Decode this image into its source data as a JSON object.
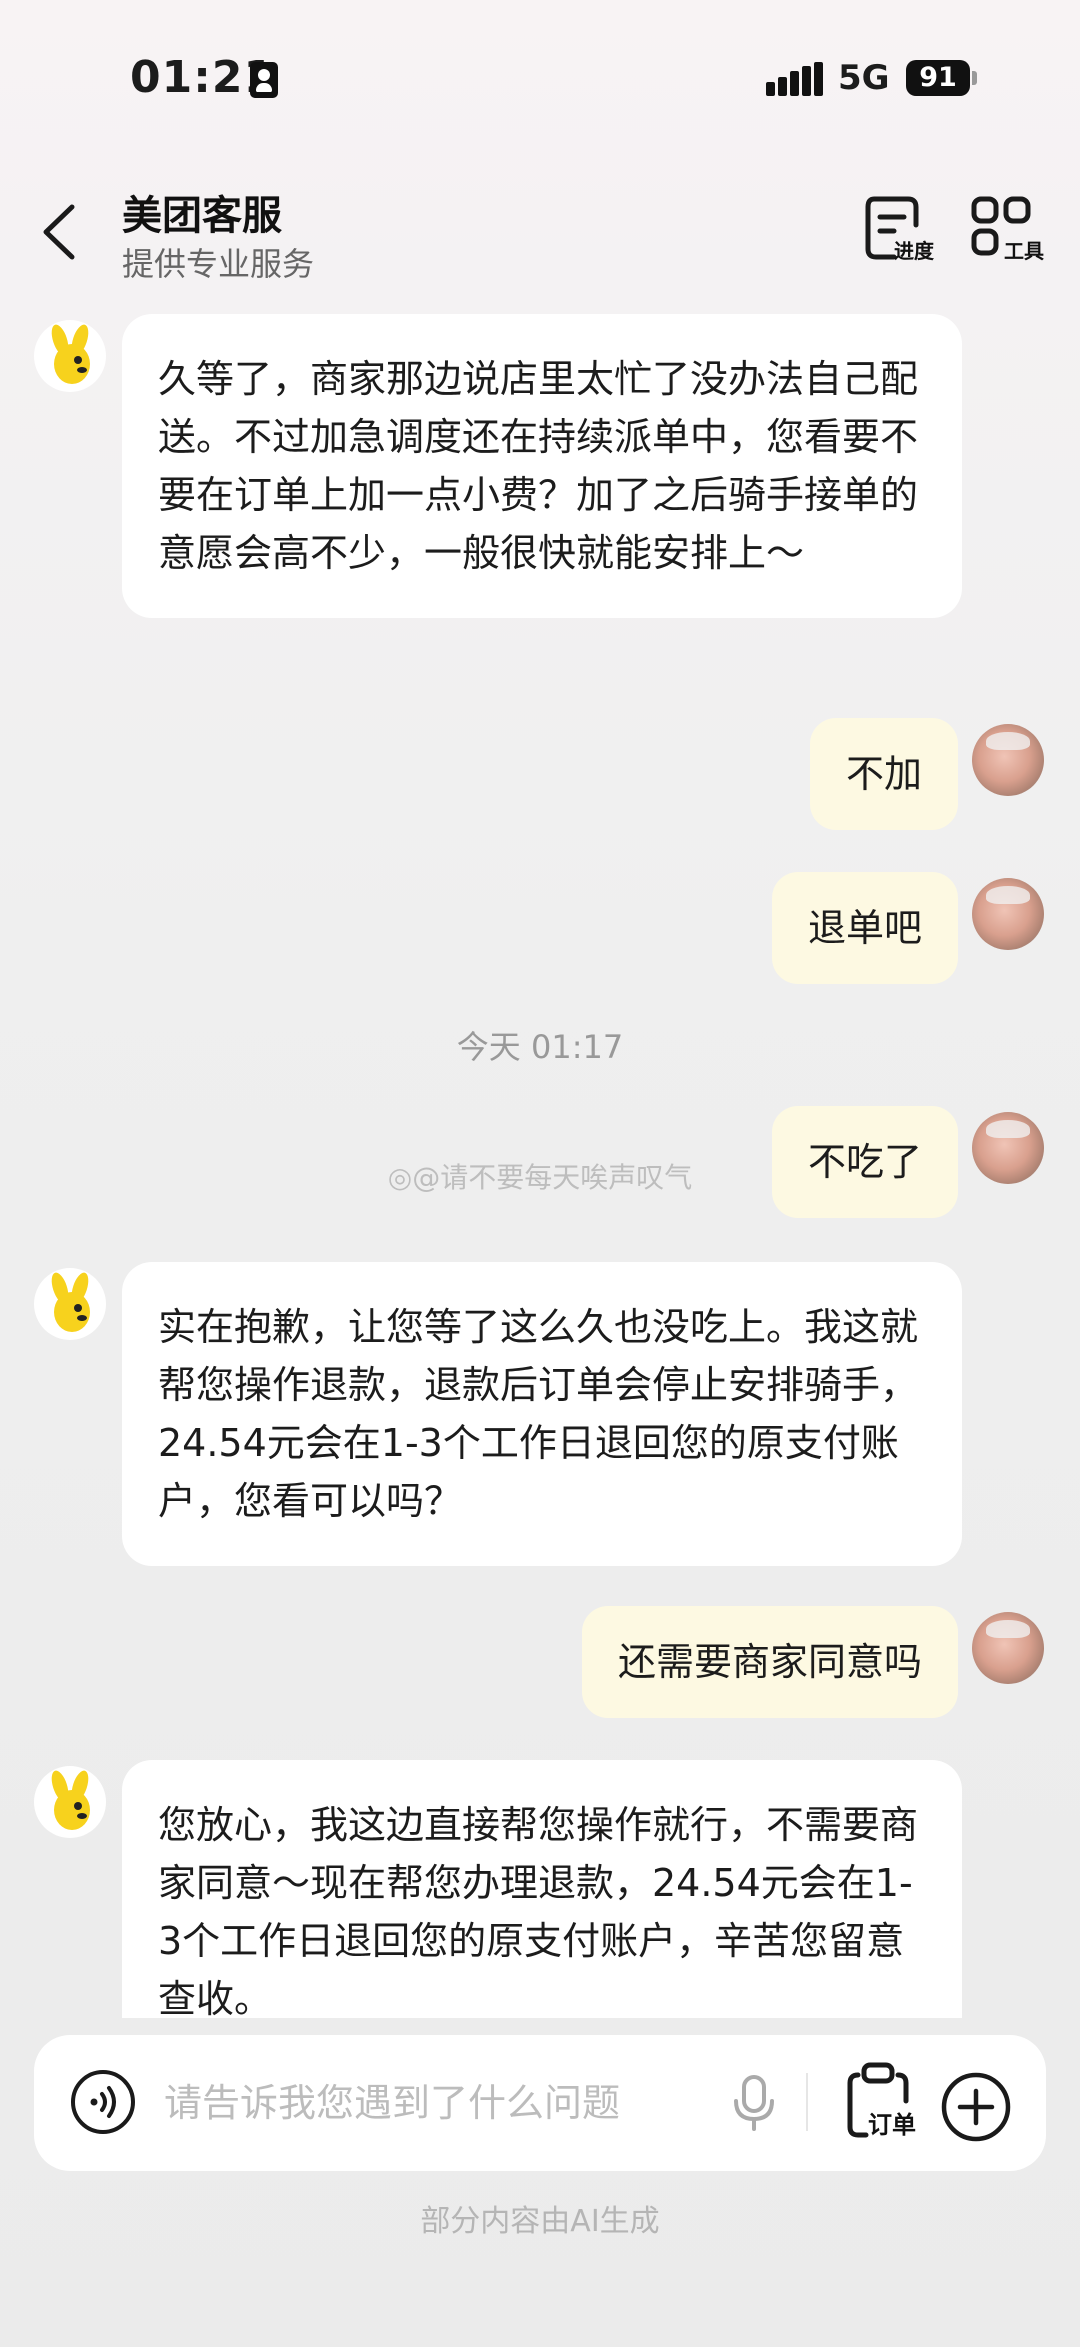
{
  "status_bar": {
    "time": "01:21",
    "network": "5G",
    "battery": "91"
  },
  "header": {
    "title": "美团客服",
    "subtitle": "提供专业服务",
    "progress_label": "进度",
    "tools_label": "工具"
  },
  "messages": [
    {
      "from": "bot",
      "text": "久等了，商家那边说店里太忙了没办法自己配送。不过加急调度还在持续派单中，您看要不要在订单上加一点小费？加了之后骑手接单的意愿会高不少，一般很快就能安排上～"
    },
    {
      "from": "user",
      "text": "不加"
    },
    {
      "from": "user",
      "text": "退单吧"
    },
    {
      "from": "user",
      "text": "不吃了"
    },
    {
      "from": "bot",
      "text": "实在抱歉，让您等了这么久也没吃上。我这就帮您操作退款，退款后订单会停止安排骑手，24.54元会在1-3个工作日退回您的原支付账户，您看可以吗？"
    },
    {
      "from": "user",
      "text": "还需要商家同意吗"
    },
    {
      "from": "bot",
      "text": "您放心，我这边直接帮您操作就行，不需要商家同意～现在帮您办理退款，24.54元会在1-3个工作日退回您的原支付账户，辛苦您留意查收。"
    }
  ],
  "timestamp": "今天 01:17",
  "watermark": "@请不要每天唉声叹气",
  "input": {
    "placeholder": "请告诉我您遇到了什么问题",
    "value": "",
    "order_label": "订单"
  },
  "footer_note": "部分内容由AI生成",
  "colors": {
    "user_bubble": "#fdf9e2",
    "bot_bubble": "#ffffff",
    "mascot_yellow": "#f7d21d"
  }
}
